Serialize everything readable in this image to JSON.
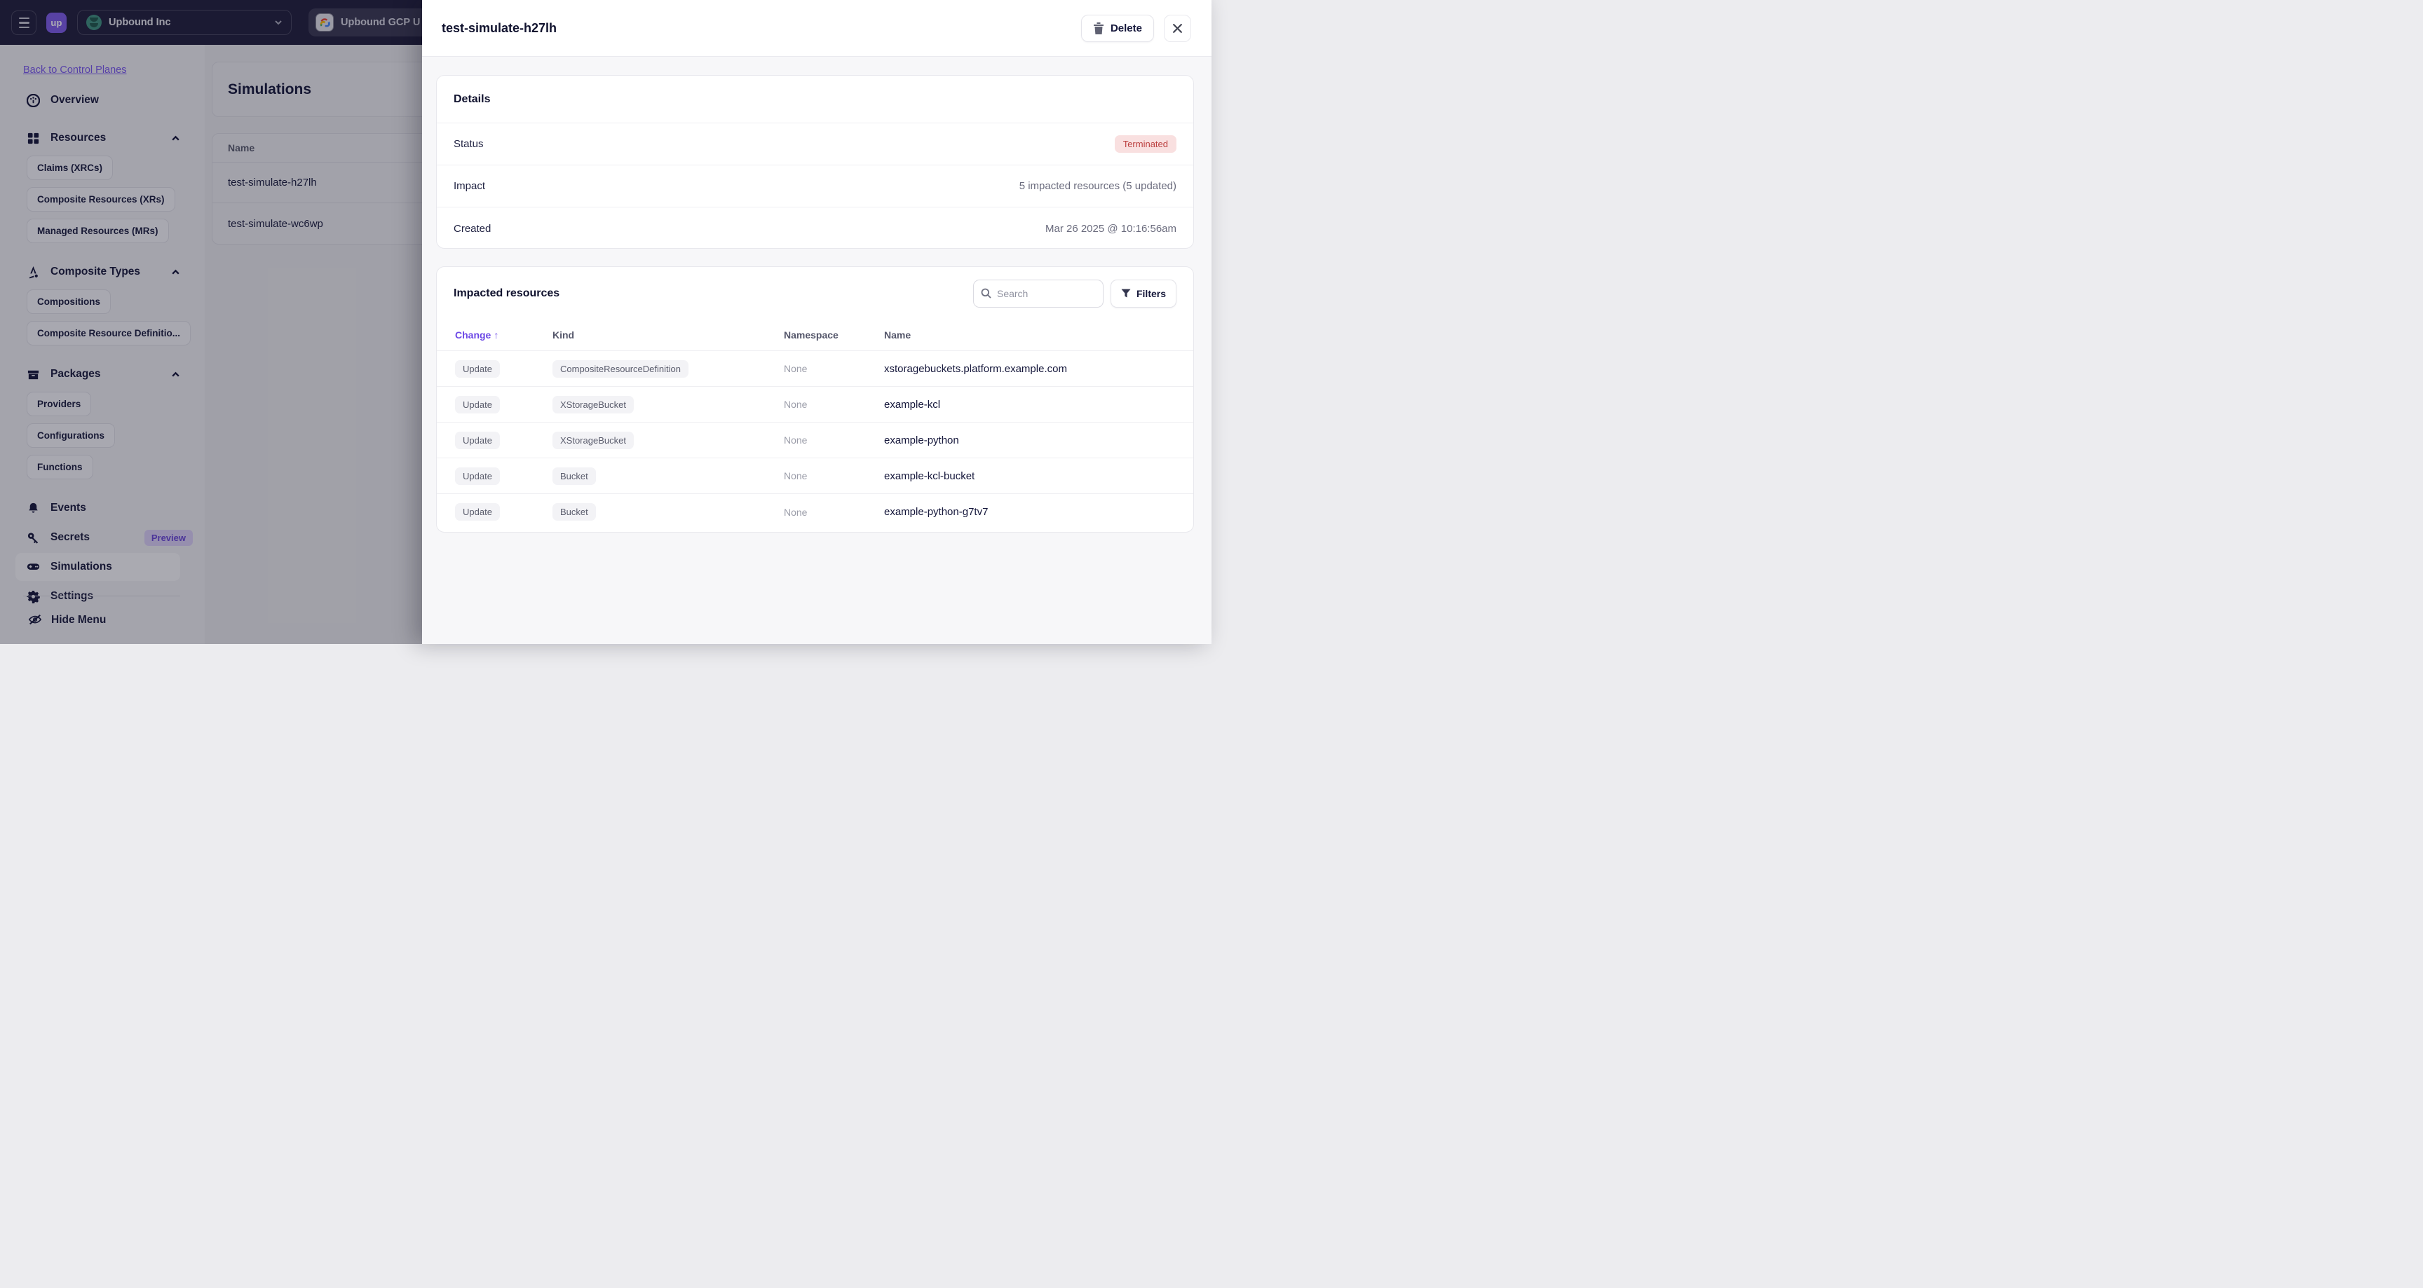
{
  "navbar": {
    "logo_text": "up",
    "org": {
      "label": "Upbound Inc"
    },
    "control_plane_tab": {
      "label": "Upbound GCP U"
    }
  },
  "sidebar": {
    "back_link": "Back to Control Planes",
    "overview": {
      "label": "Overview"
    },
    "resources": {
      "label": "Resources",
      "items": [
        "Claims (XRCs)",
        "Composite Resources (XRs)",
        "Managed Resources (MRs)"
      ]
    },
    "composite_types": {
      "label": "Composite Types",
      "items": [
        "Compositions",
        "Composite Resource Definitio..."
      ]
    },
    "packages": {
      "label": "Packages",
      "items": [
        "Providers",
        "Configurations",
        "Functions"
      ]
    },
    "events": {
      "label": "Events"
    },
    "secrets": {
      "label": "Secrets",
      "badge": "Preview"
    },
    "simulations": {
      "label": "Simulations"
    },
    "settings": {
      "label": "Settings"
    },
    "hide_menu": "Hide Menu"
  },
  "main": {
    "page_title": "Simulations",
    "table": {
      "name_header": "Name",
      "rows": [
        "test-simulate-h27lh",
        "test-simulate-wc6wp"
      ]
    }
  },
  "panel": {
    "title": "test-simulate-h27lh",
    "delete_label": "Delete",
    "details": {
      "heading": "Details",
      "status_label": "Status",
      "status_value": "Terminated",
      "impact_label": "Impact",
      "impact_value": "5 impacted resources (5 updated)",
      "created_label": "Created",
      "created_value": "Mar 26 2025 @ 10:16:56am"
    },
    "impacted": {
      "heading": "Impacted resources",
      "search_placeholder": "Search",
      "filters_label": "Filters",
      "columns": {
        "change": "Change",
        "kind": "Kind",
        "namespace": "Namespace",
        "name": "Name"
      },
      "sort": {
        "column": "Change",
        "direction": "asc",
        "arrow": "↑"
      },
      "rows": [
        {
          "change": "Update",
          "kind": "CompositeResourceDefinition",
          "namespace": "None",
          "name": "xstoragebuckets.platform.example.com"
        },
        {
          "change": "Update",
          "kind": "XStorageBucket",
          "namespace": "None",
          "name": "example-kcl"
        },
        {
          "change": "Update",
          "kind": "XStorageBucket",
          "namespace": "None",
          "name": "example-python"
        },
        {
          "change": "Update",
          "kind": "Bucket",
          "namespace": "None",
          "name": "example-kcl-bucket"
        },
        {
          "change": "Update",
          "kind": "Bucket",
          "namespace": "None",
          "name": "example-python-g7tv7"
        }
      ]
    }
  },
  "colors": {
    "navbar_bg": "#201E3B",
    "brand_purple": "#7D5BE9",
    "accent_purple": "#6C48E6",
    "link_purple": "#7A58EE",
    "terminated_bg": "#F9E0E0",
    "terminated_text": "#BC4040",
    "preview_badge_bg": "#DCD2F7",
    "preview_badge_text": "#6A48D8"
  }
}
